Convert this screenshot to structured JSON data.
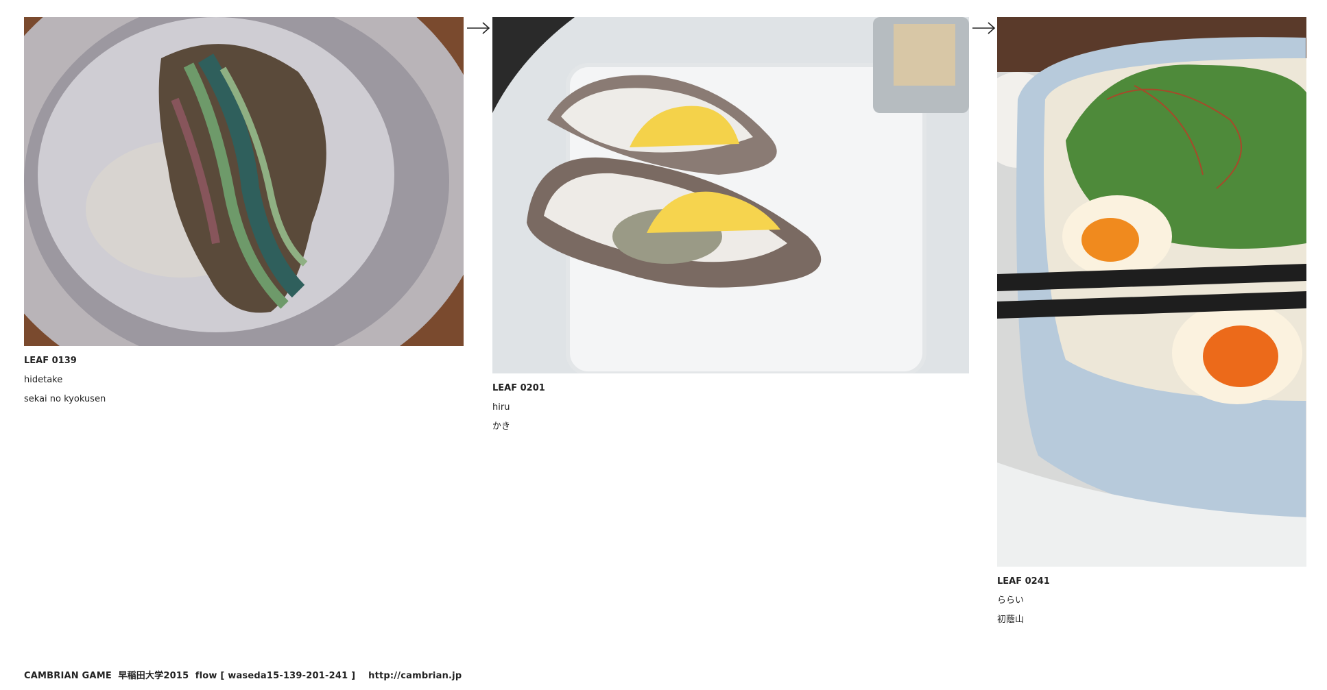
{
  "leaves": [
    {
      "id": "LEAF 0139",
      "author": "hidetake",
      "title": "sekai no kyokusen",
      "image": "giant clam in a metal bowl"
    },
    {
      "id": "LEAF 0201",
      "author": "hiru",
      "title": "かき",
      "image": "grilled oysters with lemon on a white tray"
    },
    {
      "id": "LEAF 0241",
      "author": "ららい",
      "title": "初蔭山",
      "image": "ramen bowl with salad, eggs and chopsticks"
    }
  ],
  "arrows": [
    "arrow-right-icon",
    "arrow-right-icon"
  ],
  "footer": {
    "text": "CAMBRIAN GAME  早稲田大学2015  flow [ waseda15-139-201-241 ]    http://cambrian.jp"
  }
}
